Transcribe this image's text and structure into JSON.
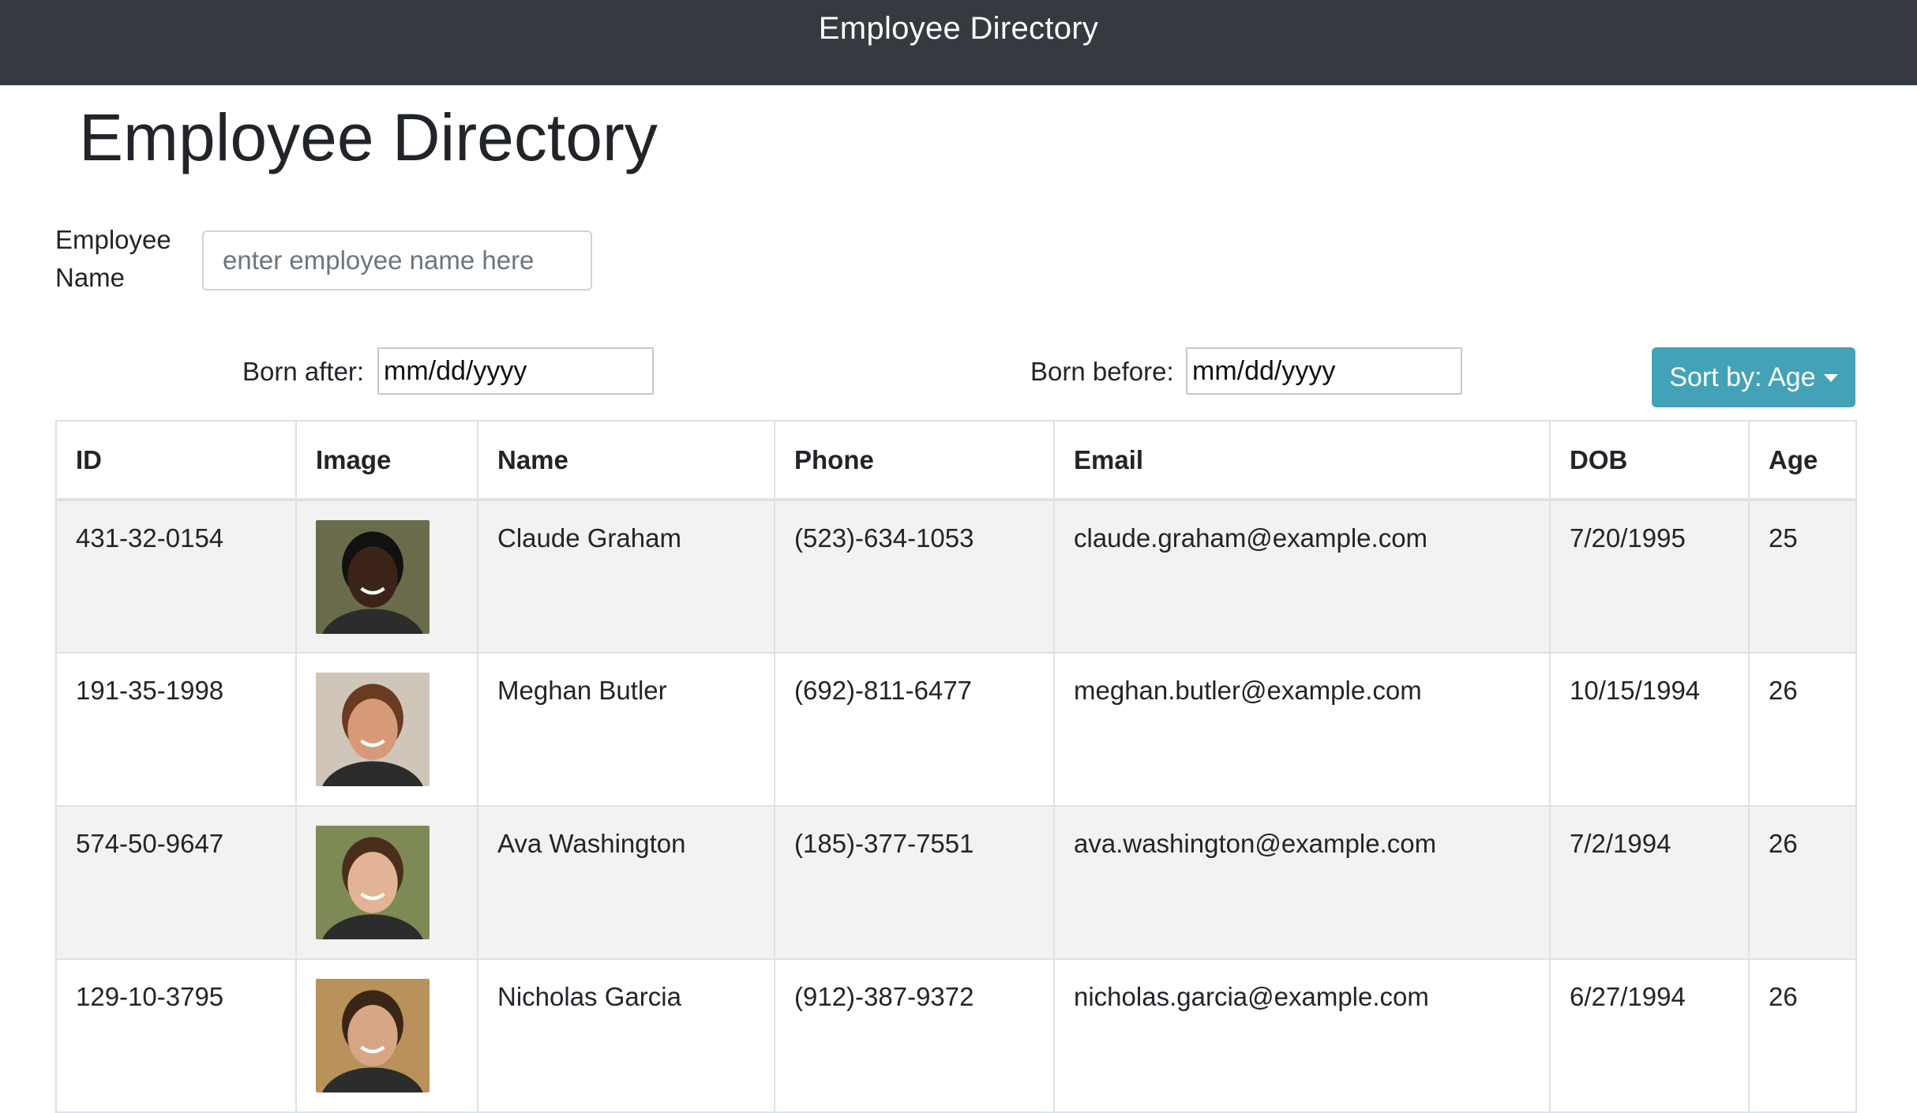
{
  "navbar": {
    "title": "Employee Directory"
  },
  "page": {
    "title": "Employee Directory"
  },
  "search": {
    "label": "Employee Name",
    "placeholder": "enter employee name here"
  },
  "filters": {
    "born_after_label": "Born after:",
    "born_after_value": "mm/dd/yyyy",
    "born_before_label": "Born before:",
    "born_before_value": "mm/dd/yyyy"
  },
  "sort": {
    "label": "Sort by: Age"
  },
  "table": {
    "headers": [
      "ID",
      "Image",
      "Name",
      "Phone",
      "Email",
      "DOB",
      "Age"
    ],
    "rows": [
      {
        "id": "431-32-0154",
        "name": "Claude Graham",
        "phone": "(523)-634-1053",
        "email": "claude.graham@example.com",
        "dob": "7/20/1995",
        "age": "25",
        "avatar_skin": "#3b2417",
        "avatar_bg": "#6a6b4a",
        "avatar_hair": "#111111"
      },
      {
        "id": "191-35-1998",
        "name": "Meghan Butler",
        "phone": "(692)-811-6477",
        "email": "meghan.butler@example.com",
        "dob": "10/15/1994",
        "age": "26",
        "avatar_skin": "#d79a78",
        "avatar_bg": "#cfc6b9",
        "avatar_hair": "#6b3a22"
      },
      {
        "id": "574-50-9647",
        "name": "Ava Washington",
        "phone": "(185)-377-7551",
        "email": "ava.washington@example.com",
        "dob": "7/2/1994",
        "age": "26",
        "avatar_skin": "#e2b394",
        "avatar_bg": "#7d8a55",
        "avatar_hair": "#4a2e1c"
      },
      {
        "id": "129-10-3795",
        "name": "Nicholas Garcia",
        "phone": "(912)-387-9372",
        "email": "nicholas.garcia@example.com",
        "dob": "6/27/1994",
        "age": "26",
        "avatar_skin": "#d8a585",
        "avatar_bg": "#b8925a",
        "avatar_hair": "#3a2616"
      }
    ]
  }
}
